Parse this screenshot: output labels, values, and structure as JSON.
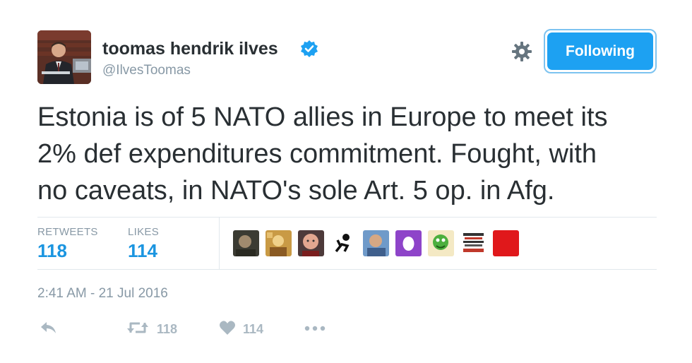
{
  "author": {
    "name": "toomas hendrik ilves",
    "handle": "@IlvesToomas",
    "verified_icon": "verified-badge-icon",
    "avatar": "profile-photo"
  },
  "header": {
    "follow_label": "Following",
    "settings_icon": "gear-icon"
  },
  "tweet": {
    "lines": [
      "Estonia is of 5 NATO allies in Europe to meet its",
      "2% def expenditures commitment. Fought, with",
      "no caveats, in NATO's sole Art. 5 op. in Afg."
    ],
    "timestamp": "2:41 AM - 21 Jul 2016"
  },
  "stats": {
    "retweets_label": "RETWEETS",
    "retweets_value": "118",
    "likes_label": "LIKES",
    "likes_value": "114"
  },
  "actions": {
    "reply_icon": "reply-icon",
    "retweet_icon": "retweet-icon",
    "retweet_count": "118",
    "like_icon": "heart-icon",
    "like_count": "114",
    "more_icon": "more-dots-icon"
  },
  "colors": {
    "accent": "#1da1f2",
    "stat_blue": "#1b95e0",
    "muted": "#8899a6",
    "text": "#292f33"
  }
}
